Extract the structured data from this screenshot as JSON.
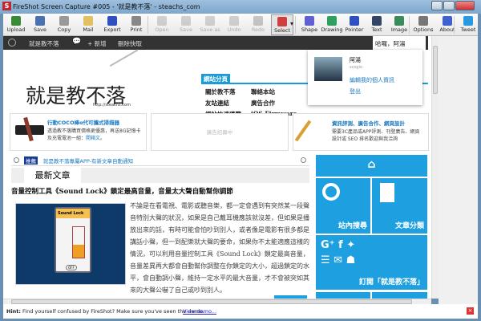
{
  "window": {
    "title": "FireShot Screen Capture #005 - '就是教不落' - steachs_com",
    "logo": "S"
  },
  "toolbar": {
    "buttons": [
      {
        "label": "Upload",
        "icon": "upload-icon",
        "enabled": true,
        "color": "#3a8a3a"
      },
      {
        "label": "Save",
        "icon": "save-icon",
        "enabled": true,
        "color": "#4a70b0"
      },
      {
        "label": "Copy",
        "icon": "copy-icon",
        "enabled": true,
        "color": "#999999"
      },
      {
        "label": "Mail",
        "icon": "mail-icon",
        "enabled": true,
        "color": "#e0c060"
      },
      {
        "label": "Export",
        "icon": "export-icon",
        "enabled": true,
        "color": "#3050c0"
      },
      {
        "label": "Print",
        "icon": "print-icon",
        "enabled": true,
        "color": "#888888"
      },
      {
        "label": "Open",
        "icon": "open-icon",
        "enabled": false,
        "color": "#888888"
      },
      {
        "label": "Save",
        "icon": "save-icon",
        "enabled": false,
        "color": "#888888"
      },
      {
        "label": "Save as",
        "icon": "save-as-icon",
        "enabled": false,
        "color": "#888888"
      },
      {
        "label": "Undo",
        "icon": "undo-icon",
        "enabled": false,
        "color": "#888888"
      },
      {
        "label": "Redo",
        "icon": "redo-icon",
        "enabled": false,
        "color": "#666666"
      },
      {
        "label": "Select",
        "icon": "select-icon",
        "enabled": true,
        "color": "#d04040"
      },
      {
        "label": "Shape",
        "icon": "shape-icon",
        "enabled": true,
        "color": "#6060d0"
      },
      {
        "label": "Drawing",
        "icon": "drawing-icon",
        "enabled": true,
        "color": "#30a060"
      },
      {
        "label": "Pointer",
        "icon": "pointer-icon",
        "enabled": true,
        "color": "#3050c0"
      },
      {
        "label": "Text",
        "icon": "text-icon",
        "enabled": true,
        "color": "#334466"
      },
      {
        "label": "Image",
        "icon": "image-icon",
        "enabled": true,
        "color": "#3a8a5a"
      },
      {
        "label": "Options",
        "icon": "options-icon",
        "enabled": true,
        "color": "#777777"
      },
      {
        "label": "About",
        "icon": "about-icon",
        "enabled": true,
        "color": "#4060d0"
      },
      {
        "label": "Tweet",
        "icon": "twitter-icon",
        "enabled": true,
        "color": "#2a9ae0"
      }
    ]
  },
  "adminbar": {
    "site": "就是教不落",
    "new": "+ 新增",
    "cache": "刪除快取",
    "greeting": "哈囉，阿湯"
  },
  "popup": {
    "name": "阿湯",
    "username": "scogio",
    "edit": "編輯我的個人資訊",
    "logout": "登出"
  },
  "header": {
    "logo_text": "就是教不落",
    "logo_url": "http://steachs.com",
    "menu_title": "網站分頁",
    "menu": [
      "關於教不落",
      "聯絡本站",
      "友站連結",
      "廣告合作",
      "網站快速導覽",
      "iOS Firmware"
    ]
  },
  "ads": [
    {
      "title": "行動COCO棒α代可攜式掃描器",
      "text": "透過教不落購買價格更優惠，再送8G記憶卡及充電電池一組：",
      "link": "開箱文",
      "tail": "。"
    },
    {
      "text": "廣告招募中"
    },
    {
      "title": "資訊評測、廣告合作、網頁設計",
      "text": "需要3C產品或APP評測、刊登廣告、網頁設計或 SEO 排名歡迎與我洽詢"
    }
  ],
  "notice": {
    "badge": "推薦",
    "text": "就是教不落專屬APP-有新文章自動通知"
  },
  "section_title": "最新文章",
  "post": {
    "title": "音量控制工具《Sound Lock》鎖定最高音量，音量太大聲自動幫你調節",
    "image_label": "Sound Lock",
    "toggle": "OFF",
    "body": "不論是在看電視、電影或聽音樂，都一定會遇到有突然某一段聲音特別大聲的狀況，如果是自己戴耳機應該就沒差，但如果是播放出來的話，有時可能會怕吵到別人，或者像是電影有很多都是講話小聲，但一到配樂就大聲的要命，如果你不太能適應這樣的情況，可以利用音量控制工具《Sound Lock》鎖定最高音量，音量差異再大都會自動幫你調整在你鎖定的大小，超過鎖定的水平，會自動調小聲，維持一定水平的最大音量，才不會被突如其來的大聲公嚇了自己或吵到別人。"
  },
  "tiles": {
    "search": "站內搜尋",
    "categories": "文章分類",
    "subscribe": "訂閱「就是教不落」",
    "accent": "#1ea0e0"
  },
  "hint": {
    "label": "Hint:",
    "text": "Find yourself confused by FireShot? Make sure you've seen the demo.",
    "link": "View demo..."
  }
}
